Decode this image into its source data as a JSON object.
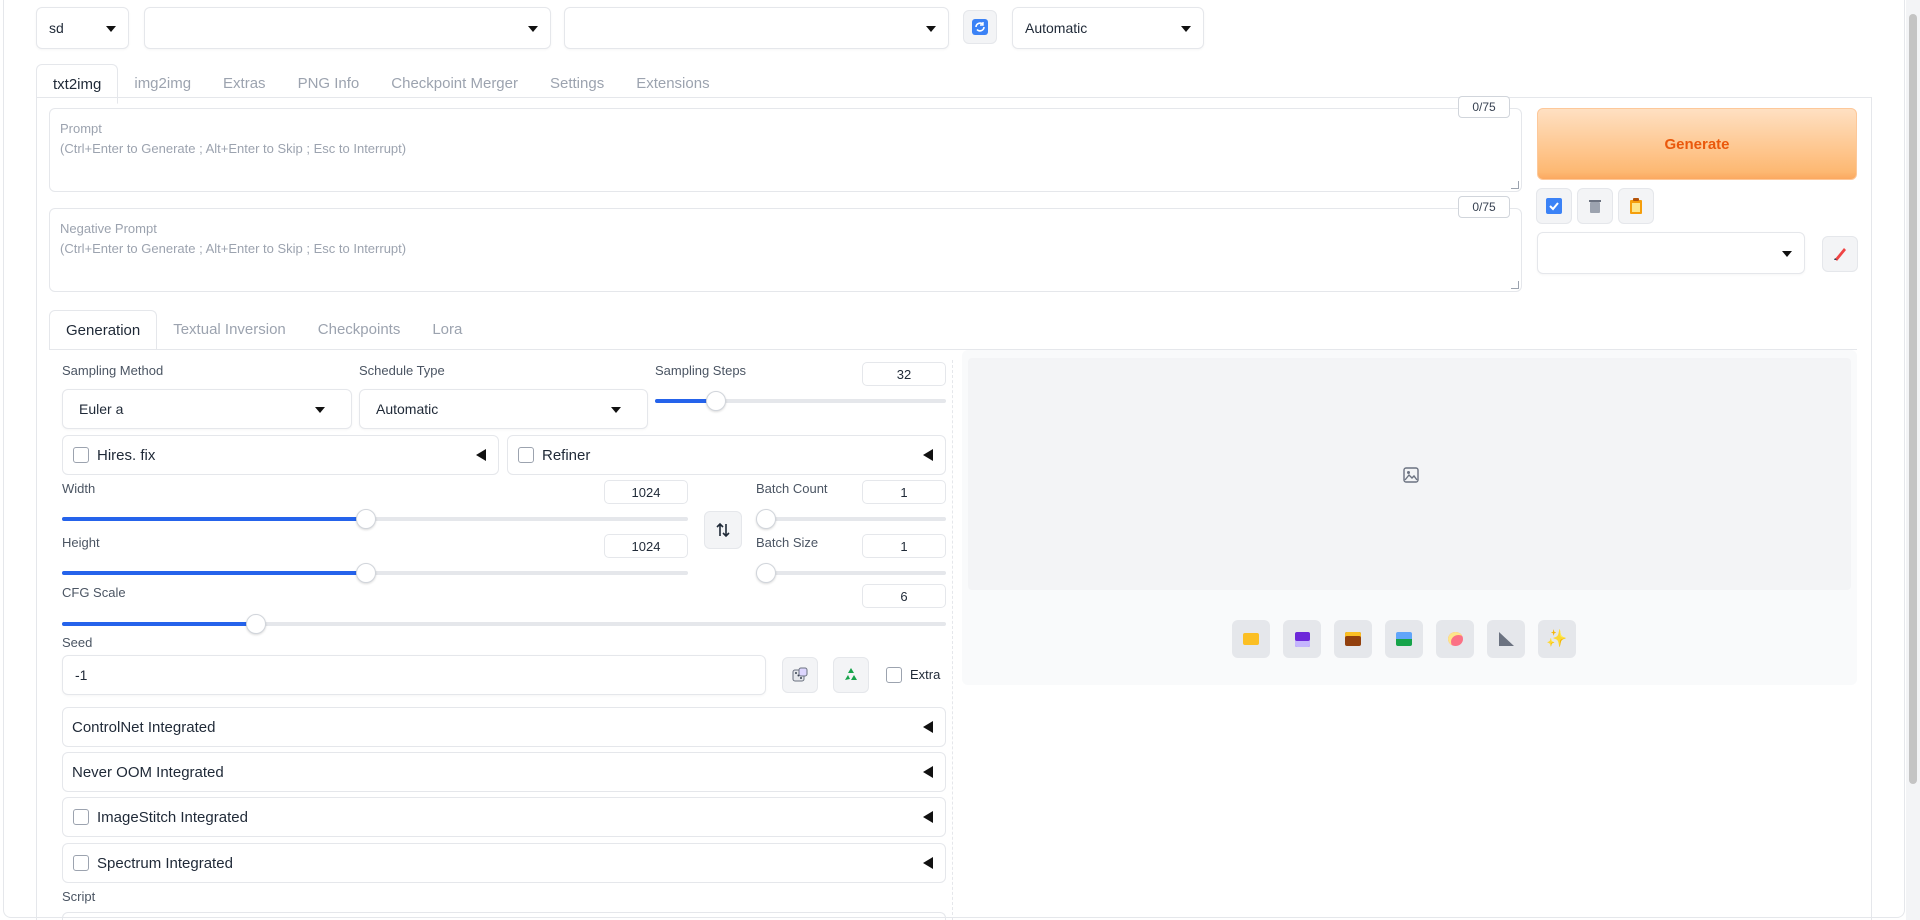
{
  "top": {
    "checkpoint_value": "sd",
    "vae_value": "",
    "textenc_value": "",
    "refresh_icon": "refresh-icon",
    "precision_value": "Automatic"
  },
  "tabs": [
    "txt2img",
    "img2img",
    "Extras",
    "PNG Info",
    "Checkpoint Merger",
    "Settings",
    "Extensions"
  ],
  "prompt": {
    "label": "Prompt",
    "placeholder": "(Ctrl+Enter to Generate ; Alt+Enter to Skip ; Esc to Interrupt)",
    "counter": "0/75"
  },
  "negative": {
    "label": "Negative Prompt",
    "placeholder": "(Ctrl+Enter to Generate ; Alt+Enter to Skip ; Esc to Interrupt)",
    "counter": "0/75"
  },
  "generate_label": "Generate",
  "style_value": "",
  "subtabs": [
    "Generation",
    "Textual Inversion",
    "Checkpoints",
    "Lora"
  ],
  "sampling": {
    "method_label": "Sampling Method",
    "method_value": "Euler a",
    "schedule_label": "Schedule Type",
    "schedule_value": "Automatic",
    "steps_label": "Sampling Steps",
    "steps_value": "32",
    "steps_fraction": 0.21
  },
  "hires_label": "Hires. fix",
  "refiner_label": "Refiner",
  "width": {
    "label": "Width",
    "value": "1024",
    "fraction": 0.485
  },
  "height": {
    "label": "Height",
    "value": "1024",
    "fraction": 0.485
  },
  "batch_count": {
    "label": "Batch Count",
    "value": "1",
    "fraction": 0.0
  },
  "batch_size": {
    "label": "Batch Size",
    "value": "1",
    "fraction": 0.0
  },
  "cfg": {
    "label": "CFG Scale",
    "value": "6",
    "fraction": 0.22
  },
  "seed": {
    "label": "Seed",
    "value": "-1",
    "extra_label": "Extra"
  },
  "accordions": [
    {
      "label": "ControlNet Integrated",
      "checkbox": false
    },
    {
      "label": "Never OOM Integrated",
      "checkbox": false
    },
    {
      "label": "ImageStitch Integrated",
      "checkbox": true
    },
    {
      "label": "Spectrum Integrated",
      "checkbox": true
    }
  ],
  "script_label": "Script",
  "colors": {
    "accent": "#2563eb",
    "generate": "#ea580c"
  }
}
